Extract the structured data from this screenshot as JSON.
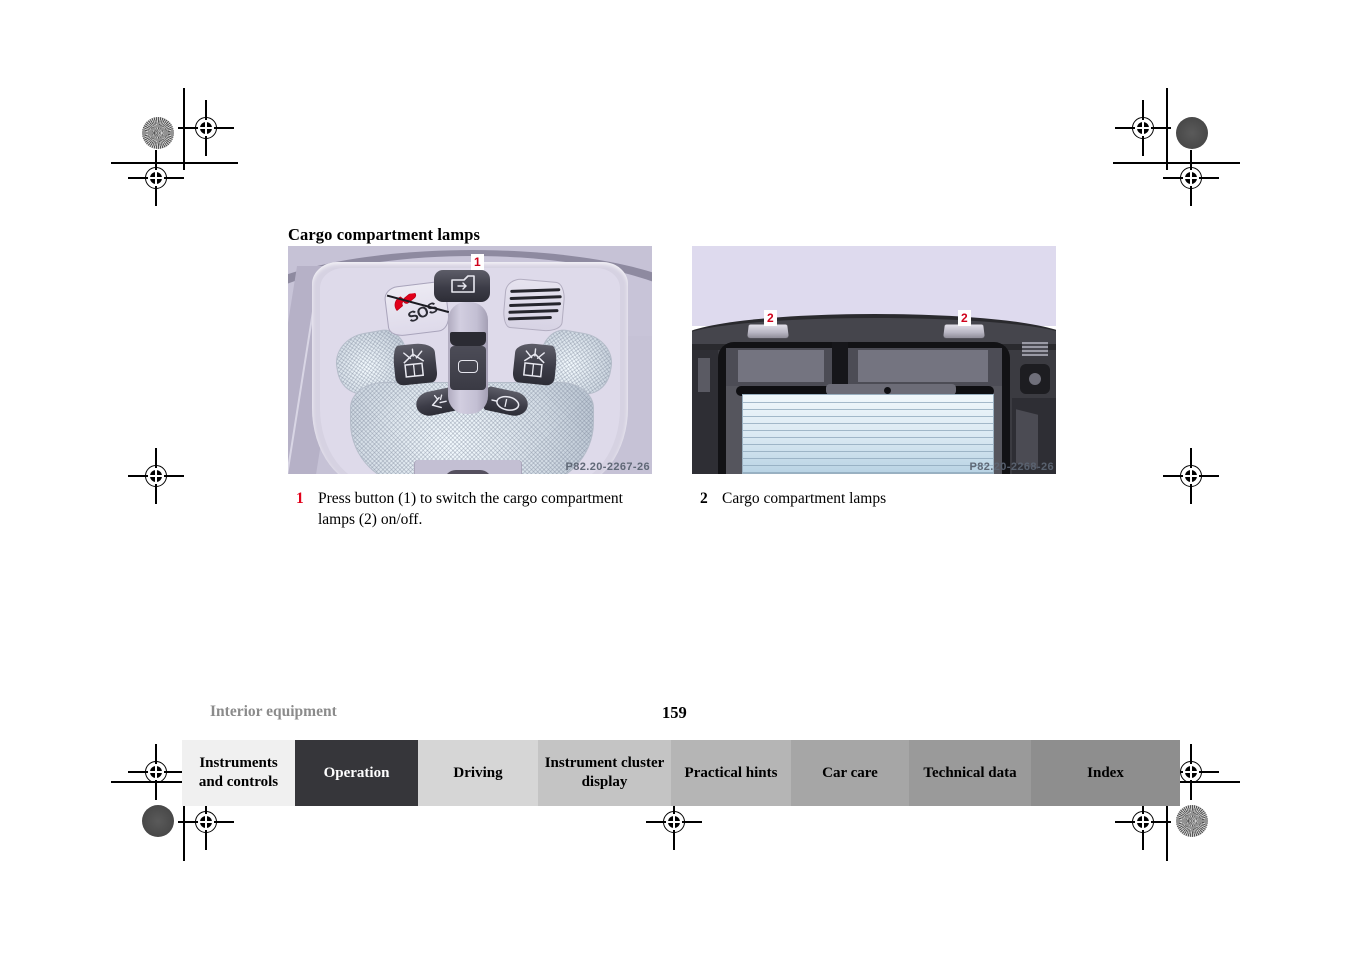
{
  "document": {
    "section_heading": "Cargo compartment lamps",
    "chapter_footer": "Interior equipment",
    "page_number": "159"
  },
  "figures": {
    "left": {
      "code": "P82.20-2267-26",
      "callouts": [
        "1"
      ],
      "alt": "Overhead console with SOS button, interior lamps and cargo compartment lamp switch",
      "console": {
        "sos_label": "SOS"
      }
    },
    "right": {
      "code": "P82.20-2268-26",
      "callouts": [
        "2",
        "2"
      ],
      "alt": "Rear cargo compartment showing two cargo compartment lamps"
    }
  },
  "captions": {
    "left": {
      "number": "1",
      "text": "Press button (1) to switch the cargo compartment lamps (2) on/off."
    },
    "right": {
      "number": "2",
      "text": "Cargo compartment lamps"
    }
  },
  "tabs": [
    {
      "label": "Instruments and controls",
      "bg": "#f0f0f0",
      "active": false
    },
    {
      "label": "Operation",
      "bg": "#36363a",
      "active": true
    },
    {
      "label": "Driving",
      "bg": "#d6d6d6",
      "active": false
    },
    {
      "label": "Instrument cluster display",
      "bg": "#c4c4c4",
      "active": false
    },
    {
      "label": "Practical hints",
      "bg": "#b5b5b5",
      "active": false
    },
    {
      "label": "Car care",
      "bg": "#a6a6a6",
      "active": false
    },
    {
      "label": "Technical data",
      "bg": "#9a9a9a",
      "active": false
    },
    {
      "label": "Index",
      "bg": "#8e8e8e",
      "active": false
    }
  ],
  "colors": {
    "callout_red": "#d0021b",
    "caption_number_red": "#e2001a",
    "footer_chapter_gray": "#8b8b8b",
    "figure_code_gray": "#5b6472"
  }
}
